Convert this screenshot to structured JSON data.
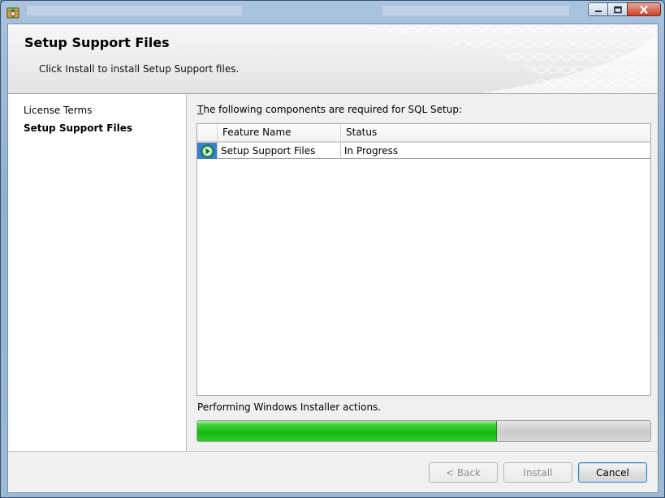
{
  "header": {
    "title": "Setup Support Files",
    "subtitle": "Click Install to install Setup Support files."
  },
  "leftnav": {
    "items": [
      {
        "label": "License Terms",
        "active": false
      },
      {
        "label": "Setup Support Files",
        "active": true
      }
    ]
  },
  "content": {
    "requirement_prefix": "T",
    "requirement_rest": "he following components are required for SQL Setup:",
    "grid": {
      "columns": [
        "Feature Name",
        "Status"
      ],
      "rows": [
        {
          "feature": "Setup Support Files",
          "status": "In Progress",
          "icon": "play-circle-icon"
        }
      ]
    },
    "status_text": "Performing Windows Installer actions.",
    "progress_percent": 66
  },
  "footer": {
    "back_label": "< Back",
    "install_label": "Install",
    "cancel_label": "Cancel"
  },
  "colors": {
    "progress_fill": "#16b812",
    "row_icon": "#2fa84f",
    "default_button_border": "#3c7fb1"
  }
}
